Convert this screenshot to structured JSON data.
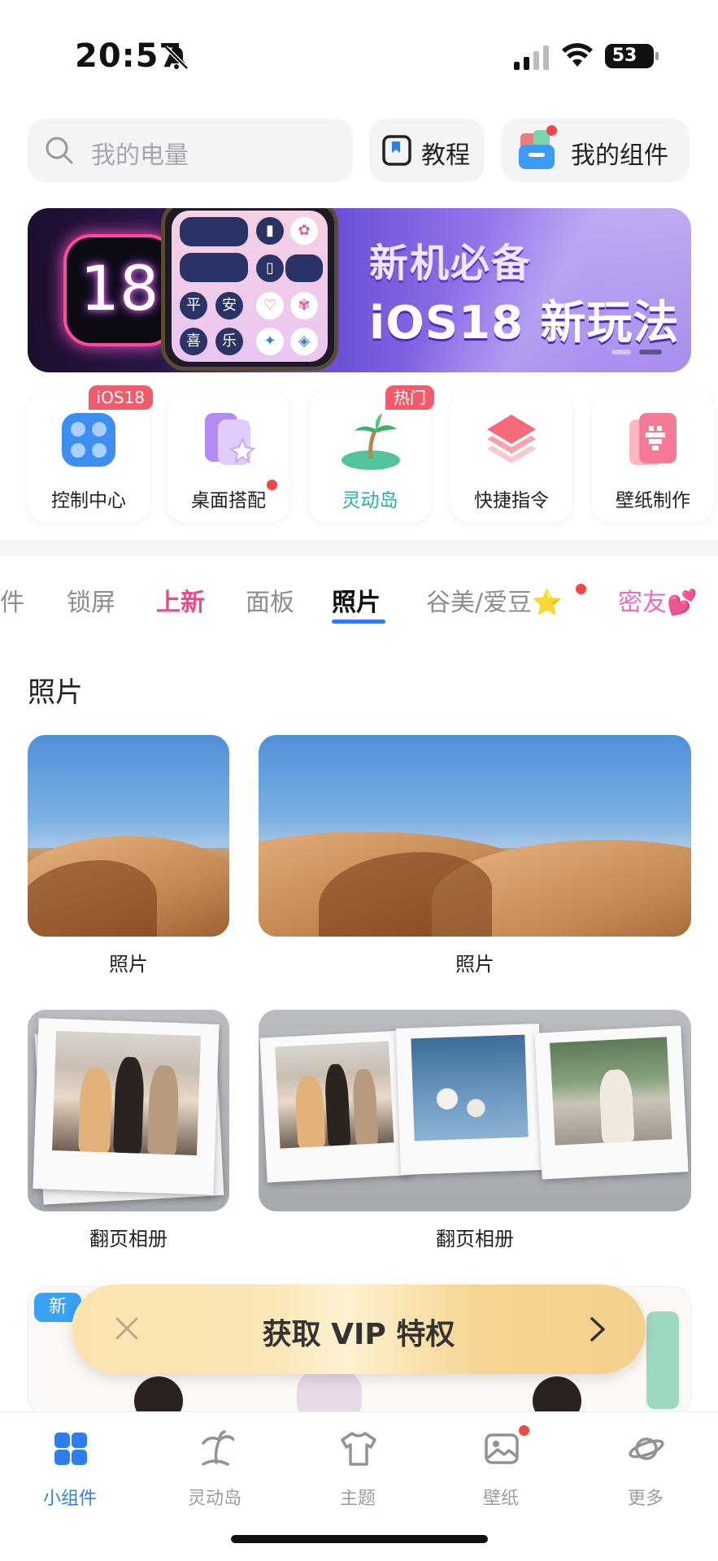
{
  "status_bar": {
    "time": "20:57",
    "battery": "53",
    "icons": [
      "bell-slash-icon",
      "cellular-signal-icon",
      "wifi-icon",
      "battery-icon"
    ]
  },
  "search": {
    "placeholder": "我的电量",
    "icon": "search-icon"
  },
  "header_buttons": {
    "tutorial": "教程",
    "my_widgets": "我的组件"
  },
  "banner": {
    "badge_number": "18",
    "title_line1": "新机必备",
    "title_line2": "iOS18 新玩法",
    "phone_chars": [
      "平",
      "安",
      "喜",
      "乐"
    ]
  },
  "categories": [
    {
      "label": "控制中心",
      "badge": "iOS18",
      "icon": "control-center-icon"
    },
    {
      "label": "桌面搭配",
      "badge": "",
      "icon": "desktop-match-icon",
      "dot": true
    },
    {
      "label": "灵动岛",
      "badge": "热门",
      "icon": "dynamic-island-icon"
    },
    {
      "label": "快捷指令",
      "badge": "",
      "icon": "shortcuts-icon"
    },
    {
      "label": "壁纸制作",
      "badge": "",
      "icon": "wallpaper-maker-icon"
    }
  ],
  "tabs": [
    {
      "label": "件"
    },
    {
      "label": "锁屏"
    },
    {
      "label": "上新"
    },
    {
      "label": "面板"
    },
    {
      "label": "照片"
    },
    {
      "label": "谷美/爱豆⭐"
    },
    {
      "label": "密友💕"
    }
  ],
  "active_tab": "照片",
  "section": {
    "title": "照片"
  },
  "widgets": [
    {
      "label": "照片",
      "size": "small"
    },
    {
      "label": "照片",
      "size": "medium"
    },
    {
      "label": "翻页相册",
      "size": "small"
    },
    {
      "label": "翻页相册",
      "size": "medium"
    }
  ],
  "promo": {
    "new_tag": "新"
  },
  "vip": {
    "text": "获取 VIP 特权"
  },
  "tabbar": [
    {
      "label": "小组件",
      "icon": "widgets-icon",
      "active": true
    },
    {
      "label": "灵动岛",
      "icon": "island-icon",
      "active": false
    },
    {
      "label": "主题",
      "icon": "tshirt-icon",
      "active": false
    },
    {
      "label": "壁纸",
      "icon": "wallpaper-icon",
      "active": false,
      "dot": true
    },
    {
      "label": "更多",
      "icon": "planet-icon",
      "active": false
    }
  ],
  "colors": {
    "accent": "#2d7ff0",
    "badge_red": "#f35a6a",
    "new_tab_pink": "#ec4b8a",
    "teal": "#1fb2b0"
  }
}
